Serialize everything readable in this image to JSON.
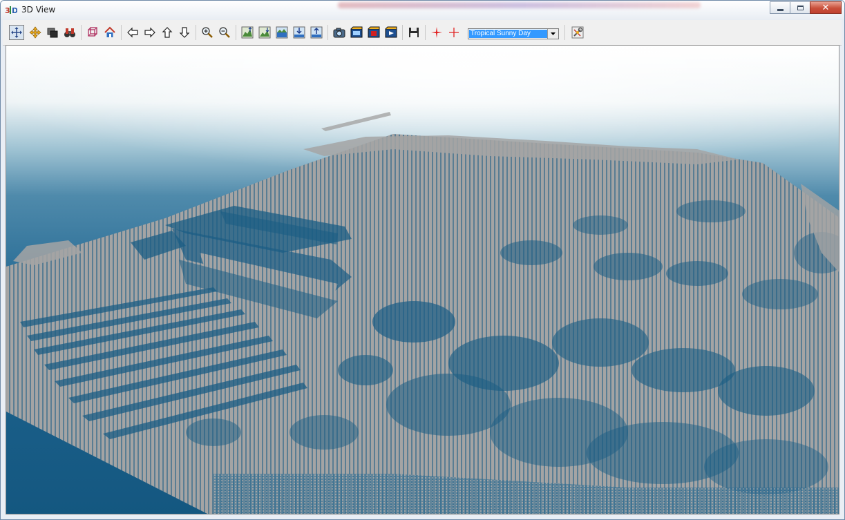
{
  "window": {
    "title": "3D View",
    "app_icon": "3d-app-icon",
    "controls": [
      "minimize-icon",
      "maximize-icon",
      "close-icon"
    ],
    "close_glyph": "✕"
  },
  "toolbar": {
    "buttons": [
      {
        "name": "navigate-tool-button",
        "icon": "navigate-arrows-icon",
        "pressed": true
      },
      {
        "name": "pan-tool-button",
        "icon": "pan-move-icon"
      },
      {
        "name": "layer-stack-button",
        "icon": "layers-icon"
      },
      {
        "name": "fly-binoculars-button",
        "icon": "binoculars-icon"
      },
      {
        "name": "bounding-box-button",
        "icon": "bounding-box-icon"
      },
      {
        "name": "home-view-button",
        "icon": "home-icon"
      },
      {
        "name": "move-left-button",
        "icon": "arrow-left-icon"
      },
      {
        "name": "move-right-button",
        "icon": "arrow-right-icon"
      },
      {
        "name": "move-up-button",
        "icon": "arrow-up-icon"
      },
      {
        "name": "move-down-button",
        "icon": "arrow-down-icon"
      },
      {
        "name": "zoom-in-button",
        "icon": "zoom-in-icon"
      },
      {
        "name": "zoom-out-button",
        "icon": "zoom-out-icon"
      },
      {
        "name": "terrain-exaggerate-button",
        "icon": "terrain-up-icon"
      },
      {
        "name": "terrain-flatten-button",
        "icon": "terrain-down-icon"
      },
      {
        "name": "water-level-button",
        "icon": "water-level-icon"
      },
      {
        "name": "lower-view-button",
        "icon": "lower-icon"
      },
      {
        "name": "raise-view-button",
        "icon": "raise-icon"
      },
      {
        "name": "capture-image-button",
        "icon": "camera-icon"
      },
      {
        "name": "record-movie-button",
        "icon": "film-icon"
      },
      {
        "name": "stop-recording-button",
        "icon": "film-stop-icon"
      },
      {
        "name": "play-movie-button",
        "icon": "film-play-icon"
      },
      {
        "name": "save-button",
        "icon": "save-disk-icon"
      },
      {
        "name": "crosshair-red-button",
        "icon": "crosshair-red-icon"
      },
      {
        "name": "crosshair-thin-button",
        "icon": "crosshair-thin-icon"
      },
      {
        "name": "settings-button",
        "icon": "settings-tools-icon"
      }
    ],
    "sky_select": {
      "value": "Tropical Sunny Day",
      "arrow_icon": "chevron-down-icon"
    }
  },
  "scene": {
    "description_icon": "point-cloud-render",
    "colors": {
      "sky_top": "#ffffff",
      "sky_mid": "#9fc3d3",
      "water": "#1b5d84",
      "points": "#a4a4a4"
    }
  }
}
